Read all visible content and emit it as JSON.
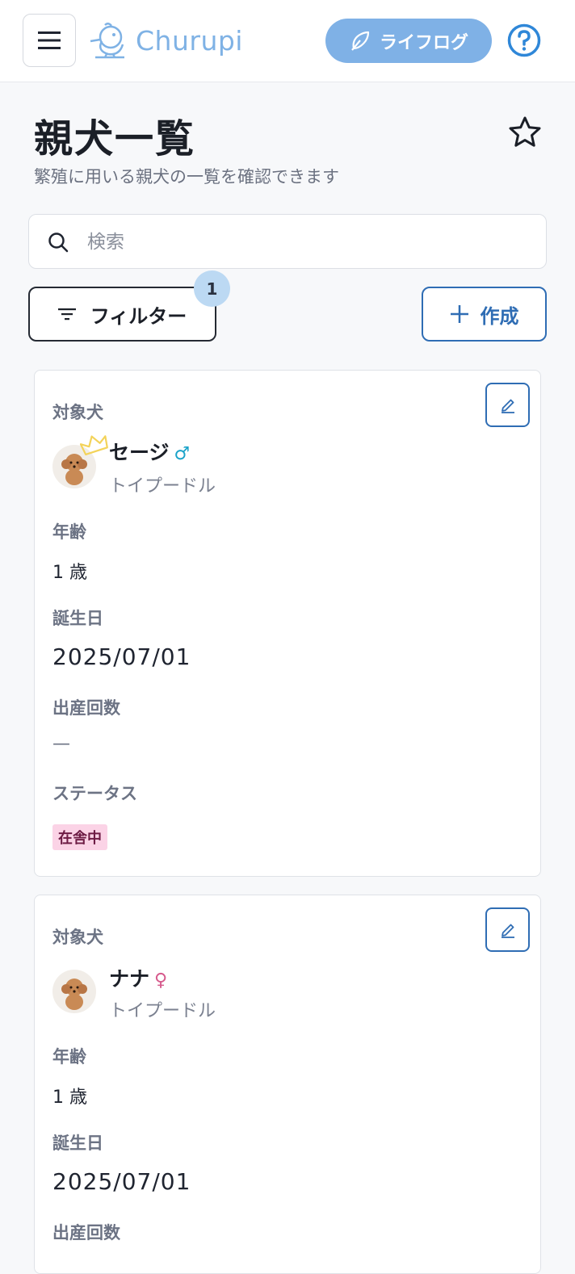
{
  "header": {
    "logo_text": "Churupi",
    "lifelog_label": "ライフログ"
  },
  "page": {
    "title": "親犬一覧",
    "subtitle": "繁殖に用いる親犬の一覧を確認できます"
  },
  "search": {
    "placeholder": "検索",
    "value": ""
  },
  "toolbar": {
    "filter_label": "フィルター",
    "filter_count": "1",
    "create_label": "作成"
  },
  "labels": {
    "target_dog": "対象犬",
    "age": "年齢",
    "birthday": "誕生日",
    "births": "出産回数",
    "status": "ステータス"
  },
  "dogs": [
    {
      "name": "セージ",
      "gender_symbol": "♂",
      "gender_color": "#1aa3c9",
      "breed": "トイプードル",
      "age": "1 歳",
      "birthday": "2025/07/01",
      "births": "—",
      "status": "在舎中",
      "featured": true
    },
    {
      "name": "ナナ",
      "gender_symbol": "♀",
      "gender_color": "#d65a8c",
      "breed": "トイプードル",
      "age": "1 歳",
      "birthday": "2025/07/01",
      "births": "",
      "status": "",
      "featured": false
    }
  ],
  "colors": {
    "accent": "#2f6db4",
    "lifelog_bg": "#7fb1e6",
    "badge_bg": "#bcd9f3",
    "status_bg": "#fbd3e6"
  }
}
